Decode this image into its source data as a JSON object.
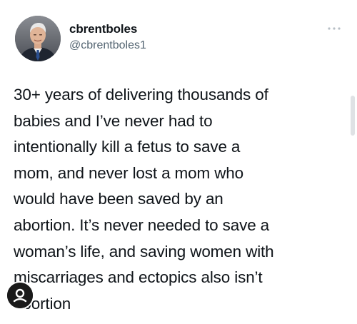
{
  "tweet": {
    "display_name": "cbrentboles",
    "handle": "@cbrentboles1",
    "text": "30+ years of delivering thousands of\nbabies and I’ve never had to\nintentionally kill a fetus to save a\nmom, and never lost a mom who\nwould have been saved by an\nabortion. It’s never needed to save a\nwoman’s life, and saving women with\nmiscarriages and ectopics also isn’t\nabortion",
    "icons": {
      "avatar": "profile-photo",
      "more": "more-options-icon",
      "badge": "user-badge-icon"
    }
  },
  "colors": {
    "text": "#0f1419",
    "secondary_text": "#536471",
    "background": "#ffffff"
  }
}
